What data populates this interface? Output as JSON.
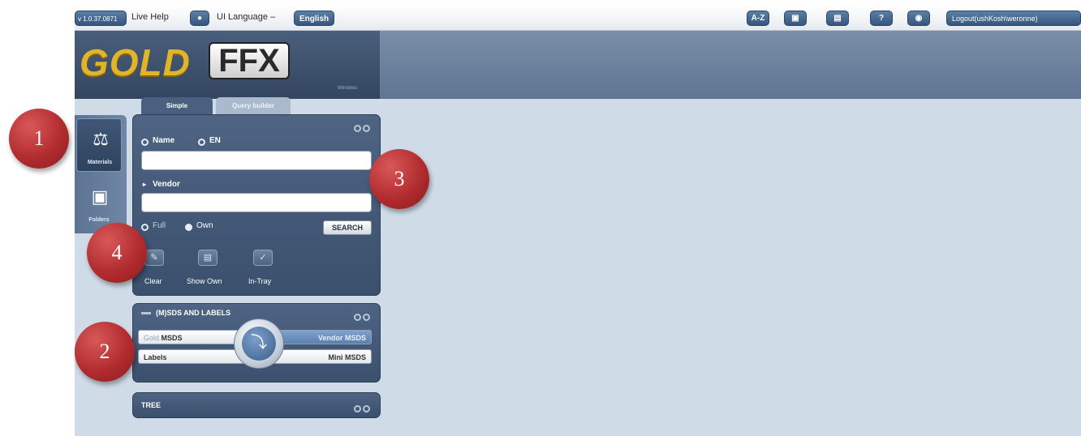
{
  "topbar": {
    "version": "v 1.0.37.0871",
    "live_help": "Live Help",
    "ui_language_label": "UI Language –",
    "ui_language_value": "English",
    "icon_az": "A-Z",
    "icon_help": "?",
    "logout": "Logout(ushKosh\\weronne)"
  },
  "header": {
    "logo_gold": "GOLD",
    "logo_ffx": "FFX",
    "logo_sub": "Windows"
  },
  "leftnav": {
    "items": [
      {
        "label": "Materials",
        "active": true
      },
      {
        "label": "Folders",
        "active": false
      }
    ]
  },
  "search_panel": {
    "tabs": [
      "Simple",
      "Query builder"
    ],
    "name_label": "Name",
    "en_label": "EN",
    "vendor_label": "Vendor",
    "scope_full": "Full",
    "scope_own": "Own",
    "search_button": "SEARCH",
    "tools": [
      "Clear",
      "Show Own",
      "In-Tray"
    ]
  },
  "sds_panel": {
    "title": "(M)SDS AND LABELS",
    "gold_msds_prefix": "Gold",
    "gold_msds": "MSDS",
    "vendor_msds": "Vendor MSDS",
    "labels": "Labels",
    "mini_msds": "Mini MSDS"
  },
  "tree_panel": {
    "title": "TREE"
  },
  "callouts": [
    "1",
    "2",
    "3",
    "4"
  ]
}
